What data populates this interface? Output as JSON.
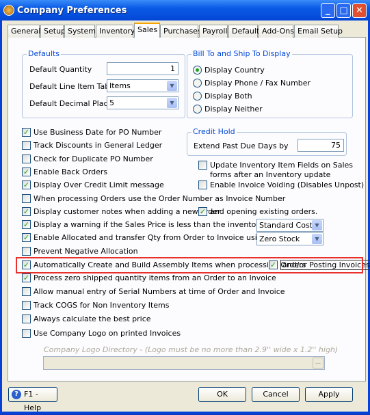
{
  "window": {
    "title": "Company Preferences",
    "minimize": "_",
    "maximize": "□",
    "close": "✕"
  },
  "tabs": [
    {
      "label": "General"
    },
    {
      "label": "Setup"
    },
    {
      "label": "System"
    },
    {
      "label": "Inventory"
    },
    {
      "label": "Sales",
      "active": true
    },
    {
      "label": "Purchases"
    },
    {
      "label": "Payroll"
    },
    {
      "label": "Default"
    },
    {
      "label": "Add-Ons"
    },
    {
      "label": "Email Setup"
    }
  ],
  "defaults": {
    "title": "Defaults",
    "quantity_label": "Default Quantity",
    "quantity": "1",
    "line_item_tab_label": "Default Line Item Tab",
    "line_item_tab": "Items",
    "decimal_label": "Default Decimal Places",
    "decimal": "5"
  },
  "bill_to": {
    "title": "Bill To and Ship To Display",
    "options": [
      {
        "label": "Display Country",
        "selected": true
      },
      {
        "label": "Display Phone / Fax Number",
        "selected": false
      },
      {
        "label": "Display Both",
        "selected": false
      },
      {
        "label": "Display Neither",
        "selected": false
      }
    ]
  },
  "credit_hold": {
    "title": "Credit Hold",
    "label": "Extend Past Due Days by",
    "value": "75"
  },
  "checks": [
    {
      "label": "Use Business Date for PO Number",
      "checked": true
    },
    {
      "label": "Track Discounts in General Ledger",
      "checked": false
    },
    {
      "label": "Check for Duplicate PO Number",
      "checked": false
    },
    {
      "label": "Enable Back Orders",
      "checked": true
    },
    {
      "label": "Display Over Credit Limit message",
      "checked": true
    },
    {
      "label": "When processing Orders use the Order Number as Invoice Number",
      "checked": false
    },
    {
      "label": "Display customer notes when adding a new order",
      "checked": true
    },
    {
      "label": "Display a warning if the Sales Price is less than the inventory items",
      "checked": true
    },
    {
      "label": "Enable Allocated and transfer Qty from Order to Invoice using :",
      "checked": true
    },
    {
      "label": "Prevent Negative Allocation",
      "checked": false
    },
    {
      "label": "Automatically Create and Build Assembly Items when processing Orders",
      "checked": true
    },
    {
      "label": "Process zero shipped quantity items from an Order to an Invoice",
      "checked": true
    },
    {
      "label": "Allow manual entry of Serial Numbers at time of Order and Invoice",
      "checked": false
    },
    {
      "label": "Track COGS for Non Inventory Items",
      "checked": false
    },
    {
      "label": "Always calculate the best price",
      "checked": false
    },
    {
      "label": "Use Company Logo on printed Invoices",
      "checked": false
    }
  ],
  "right_checks": {
    "update_inventory": {
      "label1": "Update Inventory Item Fields on Sales",
      "label2": "forms after an Inventory update",
      "checked": false
    },
    "invoice_voiding": {
      "label": "Enable Invoice Voiding (Disables Unpost)",
      "checked": false
    },
    "opening_orders": {
      "label": "and opening existing orders.",
      "checked": true
    },
    "posting_invoices": {
      "label": "and/or Posting Invoices",
      "checked": true
    }
  },
  "warning_cost": "Standard Cost",
  "allocation_mode": "Zero Stock",
  "logo": {
    "label": "Company Logo Directory - (Logo must be no more than 2.9'' wide x 1.2'' high)",
    "value": "",
    "browse": "..."
  },
  "buttons": {
    "help": "F1 - Help",
    "ok": "OK",
    "cancel": "Cancel",
    "apply": "Apply"
  },
  "highlight_color": "#e8302c"
}
